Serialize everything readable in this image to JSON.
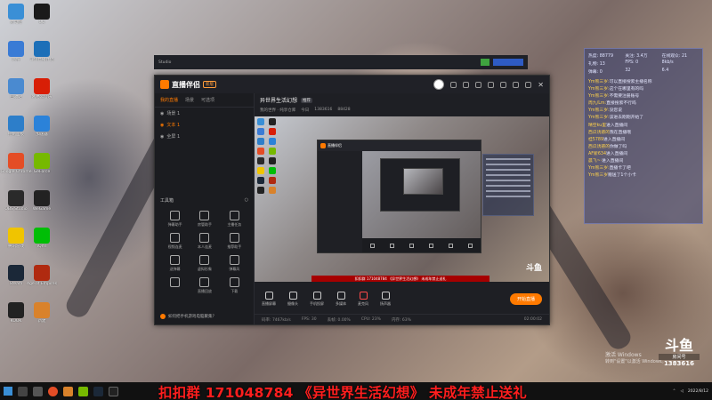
{
  "desktop_icons": [
    {
      "label": "此电脑",
      "color": "#3a8fd6"
    },
    {
      "label": "QQ",
      "color": "#1a1a1a"
    },
    {
      "label": "网络",
      "color": "#3a7bd5"
    },
    {
      "label": "斗鱼直播伴侣",
      "color": "#1c6fb8"
    },
    {
      "label": "回收站",
      "color": "#4a8ad0"
    },
    {
      "label": "网易云音乐",
      "color": "#d81e06"
    },
    {
      "label": "控制面板",
      "color": "#2d7ec9"
    },
    {
      "label": "加速器",
      "color": "#2b82d9"
    },
    {
      "label": "Google Chrome",
      "color": "#e44d26"
    },
    {
      "label": "GeForce",
      "color": "#76b900"
    },
    {
      "label": "OBS Studio",
      "color": "#2a2a2a"
    },
    {
      "label": "WeGame",
      "color": "#222"
    },
    {
      "label": "腾讯游戏",
      "color": "#f0c400"
    },
    {
      "label": "iQIYI",
      "color": "#00be06"
    },
    {
      "label": "Steam",
      "color": "#1b2838"
    },
    {
      "label": "Age of Empires",
      "color": "#b02a10"
    },
    {
      "label": "KOOK",
      "color": "#222"
    },
    {
      "label": "新建",
      "color": "#d9822b"
    }
  ],
  "obs_window": {
    "app_name": "直播伴侣",
    "version_badge": "新版",
    "side_tabs": [
      "我的直播",
      "场景",
      "可选项"
    ],
    "scenes": [
      {
        "label": "场景 1",
        "selected": false
      },
      {
        "label": "文本 1",
        "selected": true
      },
      {
        "label": "全屏 1",
        "selected": false
      }
    ],
    "tools_label": "工具箱",
    "tools": [
      "弹幕助手",
      "房管助手",
      "主播任务",
      "视频连麦",
      "本人连麦",
      "推荐助手",
      "送弹幕",
      "虚拟形象",
      "弹幕风",
      "",
      "直播回放",
      "下载"
    ],
    "phone_tip": "如何把手机游戏电脑聚集？",
    "room_title": "异世界生活幻想",
    "room_tag": "推荐",
    "room_sub": [
      "我的世界 · 纯享仓库",
      "今日",
      "1383616",
      "88428"
    ],
    "bottom_buttons": [
      "直播屏幕",
      "摄像头",
      "手机投屏",
      "多媒体",
      "麦克风",
      "扬声器"
    ],
    "start_button": "开始直播",
    "stat_bar": [
      "码率: 7467kb/s",
      "FPS: 30",
      "丢帧: 0.00%",
      "CPU: 23%",
      "内存: 63%"
    ],
    "stat_time": "02:00:02",
    "preview_ban": "扣扣群 171048784 《异世界生活幻想》 未成年禁止送礼"
  },
  "stats_panel": {
    "stats": [
      "热度: 88779",
      "关注: 3.4万",
      "在线观众: 21",
      "礼物: 13",
      "FPS: 0",
      "8kb/s",
      "弹幕: 0",
      "32",
      "6.4"
    ],
    "chat": [
      {
        "name": "Ym熊三岁:",
        "text": "可以直接搜索主播名称"
      },
      {
        "name": "Ym熊三岁:",
        "text": "这个在哪里有的吗"
      },
      {
        "name": "Ym熊三岁:",
        "text": "不需要注册账号"
      },
      {
        "name": "周九/Lm:",
        "text": "直接搜索不行吗"
      },
      {
        "name": "Ym熊三岁:",
        "text": "没您说"
      },
      {
        "name": "Ym熊三岁:",
        "text": "该进去刚刚开始了"
      },
      {
        "name": "晴空ku里",
        "text": "进入直播间"
      },
      {
        "name": "西瓜诱惑的",
        "text": "我在直播哦"
      },
      {
        "name": "桂5789",
        "text": "进入直播间"
      },
      {
        "name": "西瓜诱惑的",
        "text": "你做了吗"
      },
      {
        "name": "AF新634",
        "text": "进入直播间"
      },
      {
        "name": "晨飞~·",
        "text": "进入直播间"
      },
      {
        "name": "Ym熊三岁:",
        "text": "直播卡了吧"
      },
      {
        "name": "Ym熊三岁",
        "text": "赠送了1个小卡"
      }
    ]
  },
  "activation": {
    "line1": "激活 Windows",
    "line2": "转到\"设置\"以激活 Windows。"
  },
  "douyu": {
    "mark": "斗鱼",
    "room_label": "房间号",
    "room_number": "1383616"
  },
  "bottom_banner": "扣扣群 171048784 《异世界生活幻想》 未成年禁止送礼",
  "taskbar": {
    "date": "2022/8/12"
  }
}
